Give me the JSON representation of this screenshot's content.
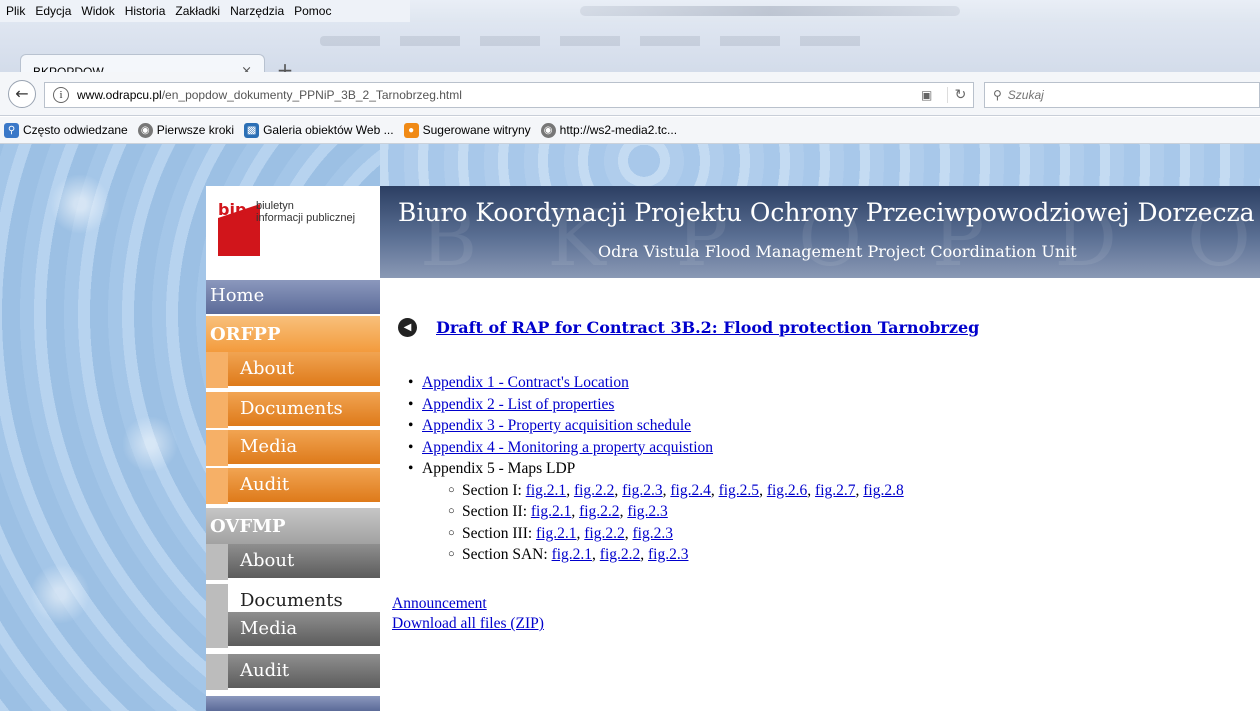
{
  "browser": {
    "menu": [
      "Plik",
      "Edycja",
      "Widok",
      "Historia",
      "Zakładki",
      "Narzędzia",
      "Pomoc"
    ],
    "tab_title": "BKPOPDOW",
    "tab_close": "×",
    "new_tab": "+",
    "url_domain": "www.odrapcu.pl",
    "url_path": "/en_popdow_dokumenty_PPNiP_3B_2_Tarnobrzeg.html",
    "search_placeholder": "Szukaj",
    "bookmarks": [
      {
        "label": "Często odwiedzane",
        "icon": "folder-search-icon",
        "color": "#3a78c8"
      },
      {
        "label": "Pierwsze kroki",
        "icon": "globe-icon",
        "color": "#777777"
      },
      {
        "label": "Galeria obiektów Web ...",
        "icon": "web-gallery-icon",
        "color": "#2b6fb5"
      },
      {
        "label": "Sugerowane witryny",
        "icon": "suggested-sites-icon",
        "color": "#f08a16"
      },
      {
        "label": "http://ws2-media2.tc...",
        "icon": "globe-icon",
        "color": "#777777"
      }
    ]
  },
  "site": {
    "bip_logo_word": "bip",
    "bip_logo_line1": "biuletyn",
    "bip_logo_line2": "informacji publicznej",
    "header_watermark": "BKPOPDOW",
    "header_title": "Biuro Koordynacji Projektu Ochrony Przeciwpowodziowej Dorzecza Odry",
    "header_subtitle": "Odra Vistula Flood Management Project Coordination Unit"
  },
  "nav": {
    "home": "Home",
    "orfpp": "ORFPP",
    "orfpp_items": [
      "About",
      "Documents",
      "Media",
      "Audit"
    ],
    "ovfmp": "OVFMP",
    "ovfmp_items": [
      "About",
      "Documents",
      "Media",
      "Audit"
    ]
  },
  "content": {
    "title": "Draft of RAP for Contract 3B.2: Flood protection Tarnobrzeg",
    "appendices": [
      "Appendix 1 - Contract's Location",
      "Appendix 2 - List of properties",
      "Appendix 3 - Property acquisition schedule",
      "Appendix 4 - Monitoring a property acquistion"
    ],
    "appendix5": "Appendix 5 - Maps LDP",
    "sections": [
      {
        "label": "Section I: ",
        "figs": [
          "fig.2.1",
          "fig.2.2",
          "fig.2.3",
          "fig.2.4",
          "fig.2.5",
          "fig.2.6",
          "fig.2.7",
          "fig.2.8"
        ]
      },
      {
        "label": "Section II: ",
        "figs": [
          "fig.2.1",
          "fig.2.2",
          "fig.2.3"
        ]
      },
      {
        "label": "Section III: ",
        "figs": [
          "fig.2.1",
          "fig.2.2",
          "fig.2.3"
        ]
      },
      {
        "label": "Section SAN: ",
        "figs": [
          "fig.2.1",
          "fig.2.2",
          "fig.2.3"
        ]
      }
    ],
    "announcement": "Announcement",
    "download_all": "Download all files (ZIP)"
  }
}
